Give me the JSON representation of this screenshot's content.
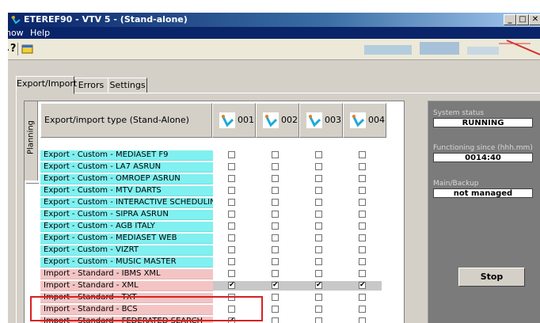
{
  "window": {
    "title": "ETEREF90 - VTV 5 - (Stand-alone)"
  },
  "title_buttons": [
    "_",
    "□",
    "✕"
  ],
  "menu": [
    "Show",
    "Help"
  ],
  "toolbar": {
    "help_tool_icon": "whats-this-pointer-icon",
    "window_tool_icon": "window-icon"
  },
  "tabs": [
    {
      "label": "Export/Import",
      "active": true
    },
    {
      "label": "Errors",
      "active": false
    },
    {
      "label": "Settings",
      "active": false
    }
  ],
  "grid": {
    "planning_label": "Planning",
    "type_header": "Export/import type  (Stand-Alone)",
    "columns": [
      "001",
      "002",
      "003",
      "004"
    ],
    "rows": [
      {
        "label": "Export - Custom - MEDIASET F9",
        "kind": "export",
        "checks": [
          false,
          false,
          false,
          false
        ]
      },
      {
        "label": "Export - Custom - LA7 ASRUN",
        "kind": "export",
        "checks": [
          false,
          false,
          false,
          false
        ]
      },
      {
        "label": "Export - Custom - OMROEP ASRUN",
        "kind": "export",
        "checks": [
          false,
          false,
          false,
          false
        ]
      },
      {
        "label": "Export - Custom - MTV DARTS",
        "kind": "export",
        "checks": [
          false,
          false,
          false,
          false
        ]
      },
      {
        "label": "Export - Custom - INTERACTIVE SCHEDULING",
        "kind": "export",
        "checks": [
          false,
          false,
          false,
          false
        ]
      },
      {
        "label": "Export - Custom - SIPRA ASRUN",
        "kind": "export",
        "checks": [
          false,
          false,
          false,
          false
        ]
      },
      {
        "label": "Export - Custom - AGB ITALY",
        "kind": "export",
        "checks": [
          false,
          false,
          false,
          false
        ]
      },
      {
        "label": "Export - Custom - MEDIASET WEB",
        "kind": "export",
        "checks": [
          false,
          false,
          false,
          false
        ]
      },
      {
        "label": "Export - Custom - VIZRT",
        "kind": "export",
        "checks": [
          false,
          false,
          false,
          false
        ]
      },
      {
        "label": "Export - Custom - MUSIC MASTER",
        "kind": "export",
        "checks": [
          false,
          false,
          false,
          false
        ]
      },
      {
        "label": "Import - Standard - IBMS XML",
        "kind": "import",
        "checks": [
          false,
          false,
          false,
          false
        ]
      },
      {
        "label": "Import - Standard - XML",
        "kind": "import",
        "selected": true,
        "checks": [
          true,
          true,
          true,
          true
        ]
      },
      {
        "label": "Import - Standard - TXT",
        "kind": "import",
        "checks": [
          false,
          false,
          false,
          false
        ]
      },
      {
        "label": "Import - Standard - BCS",
        "kind": "import",
        "checks": [
          false,
          false,
          false,
          false
        ]
      },
      {
        "label": "Import - Standard - FEDERATED SEARCH",
        "kind": "import",
        "checks": [
          true,
          false,
          false,
          false
        ]
      }
    ]
  },
  "status": {
    "system_status_label": "System status",
    "system_status_value": "RUNNING",
    "functioning_label": "Functioning since (hhh.mm)",
    "functioning_value": "0014:40",
    "main_backup_label": "Main/Backup",
    "main_backup_value": "not managed",
    "stop_label": "Stop"
  },
  "colors": {
    "export_row": "#80f0f0",
    "import_row": "#f4c4c4",
    "selected_row": "#c8c8c8",
    "highlight": "#d82020"
  }
}
